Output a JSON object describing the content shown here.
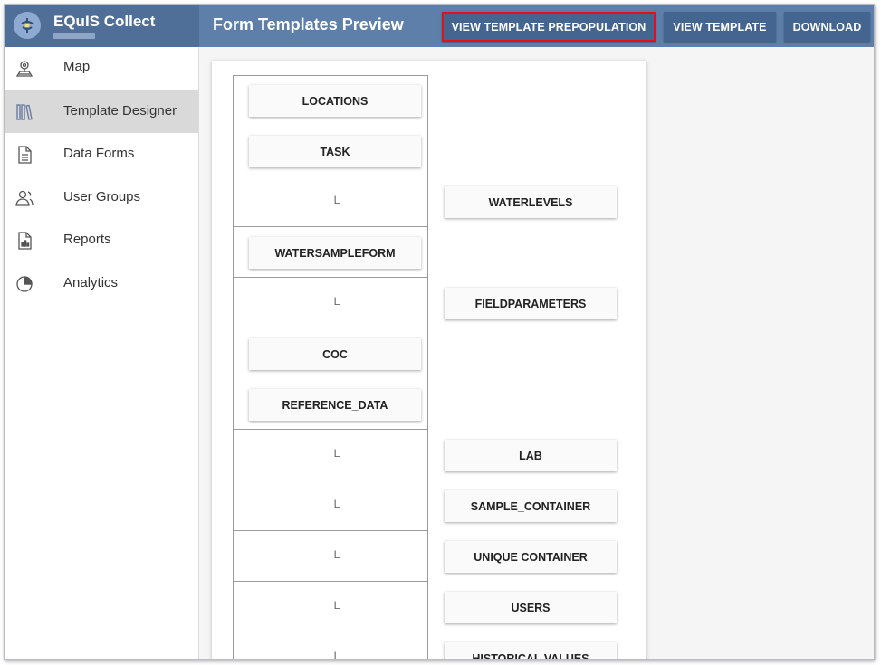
{
  "app": {
    "name": "EQuIS Collect",
    "page_title": "Form Templates Preview"
  },
  "toolbar": {
    "prepopulation_label": "VIEW TEMPLATE PREPOPULATION",
    "view_template_label": "VIEW TEMPLATE",
    "download_label": "DOWNLOAD",
    "highlight_color": "#e2101a"
  },
  "sidebar": {
    "items": [
      {
        "label": "Map",
        "icon": "map-pin-icon"
      },
      {
        "label": "Template Designer",
        "icon": "library-icon",
        "active": true
      },
      {
        "label": "Data Forms",
        "icon": "document-icon"
      },
      {
        "label": "User Groups",
        "icon": "users-icon"
      },
      {
        "label": "Reports",
        "icon": "bar-chart-file-icon"
      },
      {
        "label": "Analytics",
        "icon": "pie-chart-icon"
      }
    ]
  },
  "template": {
    "child_marker": "L",
    "forms": [
      {
        "label": "LOCATIONS",
        "level": 0
      },
      {
        "label": "TASK",
        "level": 0
      },
      {
        "label": "WATERLEVELS",
        "level": 1
      },
      {
        "label": "WATERSAMPLEFORM",
        "level": 0
      },
      {
        "label": "FIELDPARAMETERS",
        "level": 1
      },
      {
        "label": "COC",
        "level": 0
      },
      {
        "label": "REFERENCE_DATA",
        "level": 0
      },
      {
        "label": "LAB",
        "level": 1
      },
      {
        "label": "SAMPLE_CONTAINER",
        "level": 1
      },
      {
        "label": "UNIQUE CONTAINER",
        "level": 1
      },
      {
        "label": "USERS",
        "level": 1
      },
      {
        "label": "HISTORICAL VALUES",
        "level": 1
      }
    ]
  },
  "colors": {
    "topbar": "#5d7fa9",
    "brand_area": "#4f6f98",
    "toolbar_button": "#44658f",
    "sidebar_active": "#d9d9d9"
  }
}
